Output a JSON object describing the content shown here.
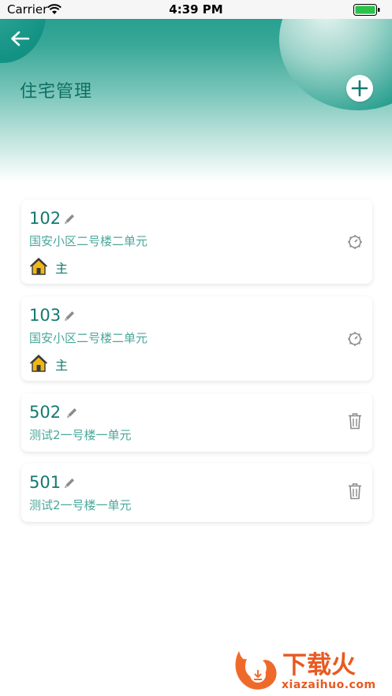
{
  "status_bar": {
    "carrier": "Carrier",
    "time": "4:39 PM"
  },
  "header": {
    "title": "住宅管理",
    "back_icon": "arrow-left-icon",
    "add_icon": "plus-icon",
    "accent_color": "#1a9a8a"
  },
  "houses": [
    {
      "unit": "102",
      "address": "国安小区二号楼二单元",
      "owner_label": "主",
      "action_icon": "settings-icon"
    },
    {
      "unit": "103",
      "address": "国安小区二号楼二单元",
      "owner_label": "主",
      "action_icon": "settings-icon"
    },
    {
      "unit": "502",
      "address": "测试2一号楼一单元",
      "action_icon": "trash-icon"
    },
    {
      "unit": "501",
      "address": "测试2一号楼一单元",
      "action_icon": "trash-icon"
    }
  ],
  "watermark": {
    "text": "下载火",
    "url": "xiazaihuo.com"
  }
}
